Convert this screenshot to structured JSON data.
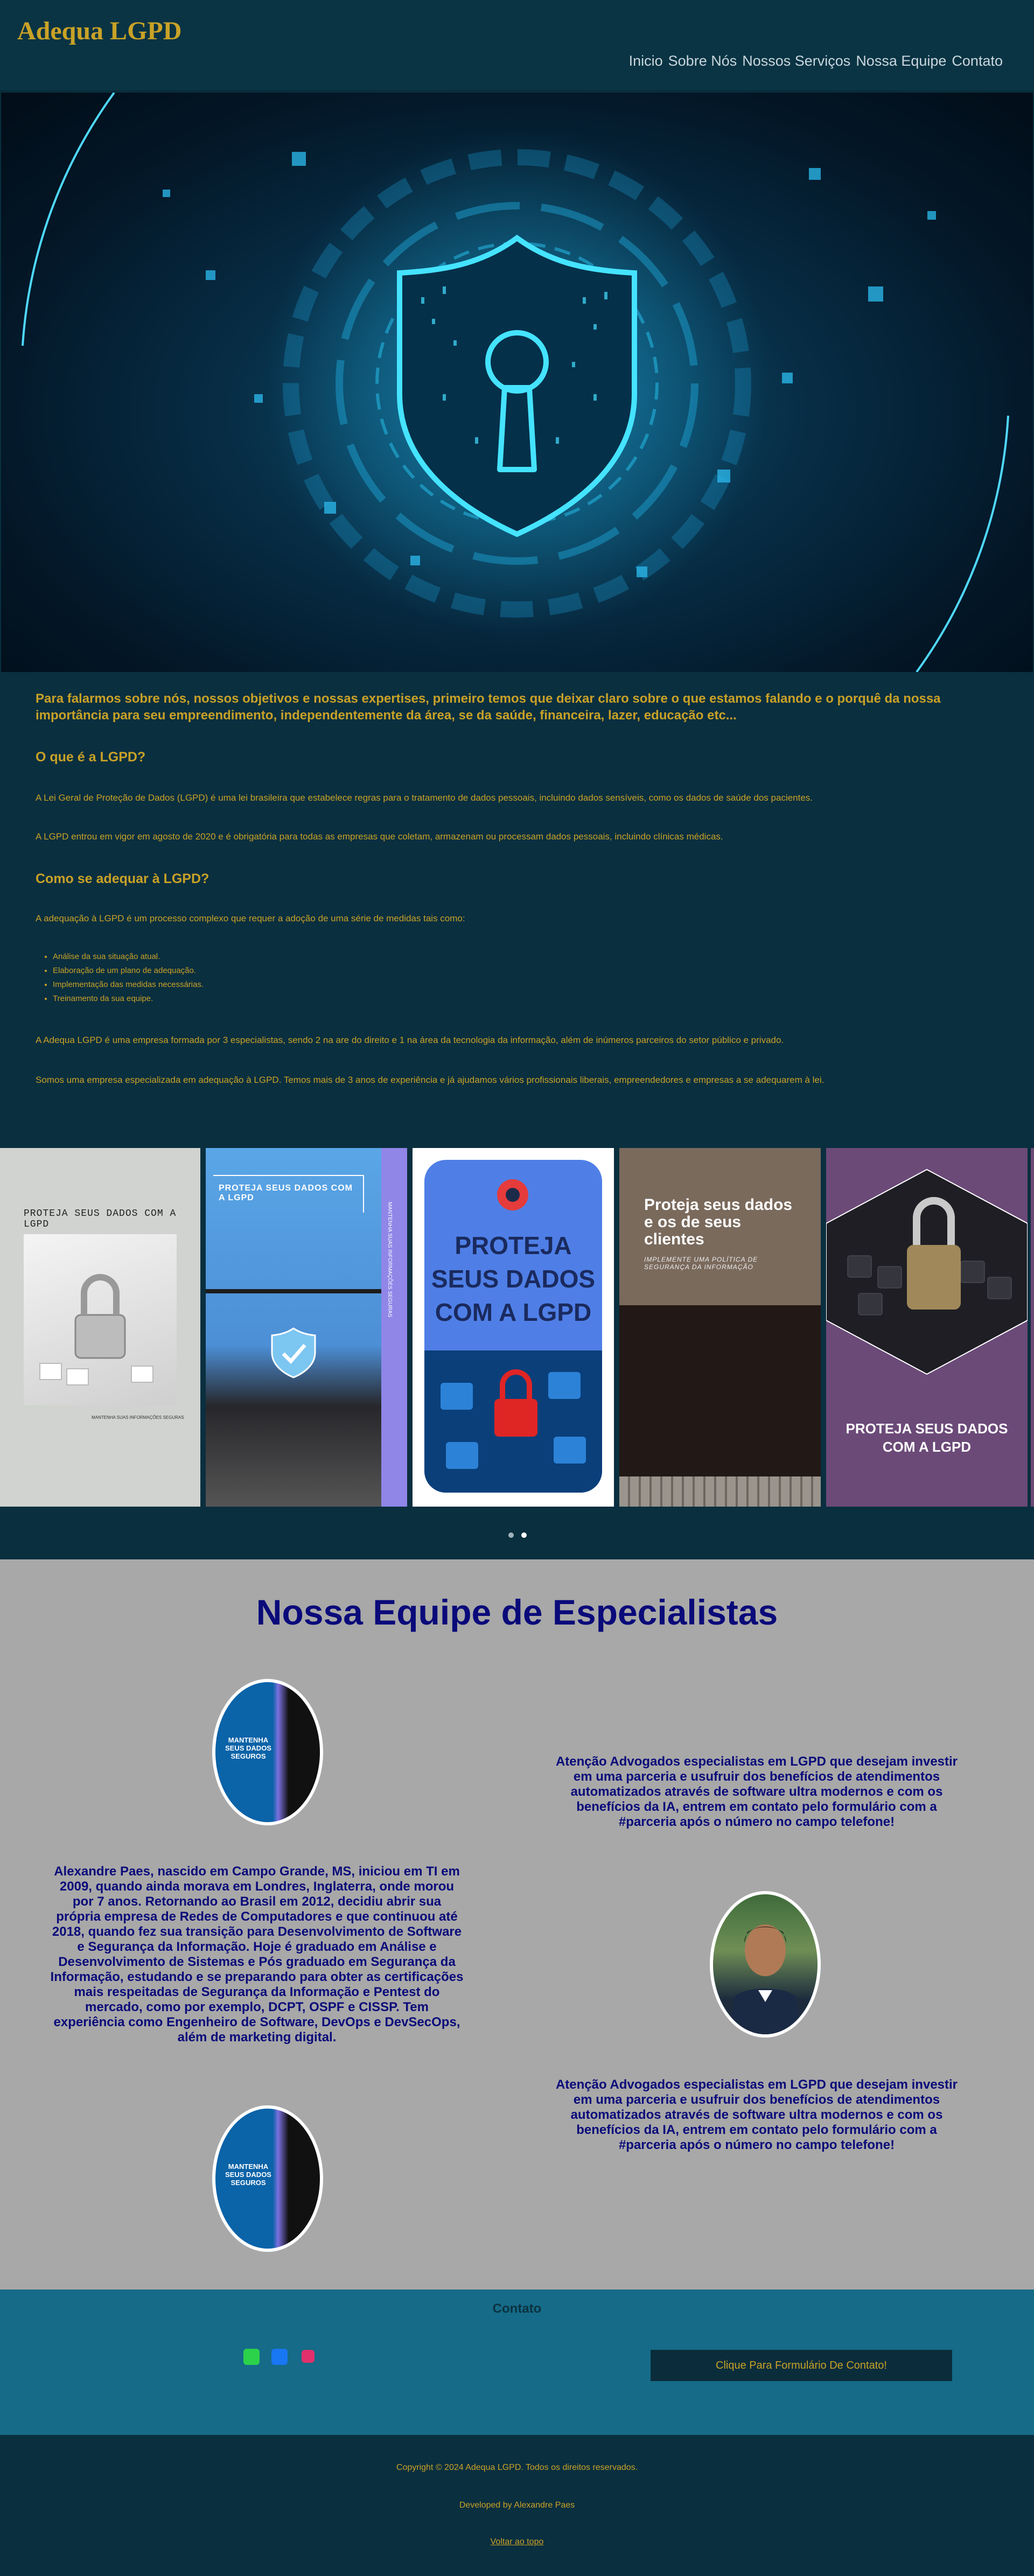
{
  "header": {
    "brand": "Adequa LGPD",
    "nav": [
      "Inicio",
      "Sobre Nós",
      "Nossos Serviços",
      "Nossa Equipe",
      "Contato"
    ]
  },
  "intro": {
    "lead": "Para falarmos sobre nós, nossos objetivos e nossas expertises, primeiro temos que deixar claro sobre o que estamos falando e o porquê da nossa importância para seu empreendimento, independentemente da área, se da saúde, financeira, lazer, educação etc...",
    "what_title": "O que é a LGPD?",
    "what_p1": "A Lei Geral de Proteção de Dados (LGPD) é uma lei brasileira que estabelece regras para o tratamento de dados pessoais, incluindo dados sensíveis, como os dados de saúde dos pacientes.",
    "what_p2": "A LGPD entrou em vigor em agosto de 2020 e é obrigatória para todas as empresas que coletam, armazenam ou processam dados pessoais, incluindo clínicas médicas.",
    "how_title": "Como se adequar à LGPD?",
    "how_p": "A adequação à LGPD é um processo complexo que requer a adoção de uma série de medidas tais como:",
    "steps": [
      "Análise da sua situação atual.",
      "Elaboração de um plano de adequação.",
      "Implementação das medidas necessárias.",
      "Treinamento da sua equipe."
    ],
    "about_p1": "A Adequa LGPD é uma empresa formada por 3 especialistas, sendo 2 na are do direito e 1 na área da tecnologia da informação, além de inúmeros parceiros do setor público e privado.",
    "about_p2": "Somos uma empresa especializada em adequação à LGPD. Temos mais de 3 anos de experiência e já ajudamos vários profissionais liberais, empreendedores e empresas a se adequarem à lei."
  },
  "carousel": {
    "slide1_title": "PROTEJA SEUS DADOS COM A LGPD",
    "slide1_caption": "MANTENHA SUAS INFORMAÇÕES SEGURAS",
    "slide2_title": "PROTEJA SEUS DADOS COM A LGPD",
    "slide2_side": "MANTENHA SUAS INFORMAÇÕES SEGURAS",
    "slide3_title": "PROTEJA SEUS DADOS COM A LGPD",
    "slide4_title": "Proteja seus dados e os de seus clientes",
    "slide4_sub": "IMPLEMENTE UMA POLÍTICA DE SEGURANÇA DA INFORMAÇÃO",
    "slide5_title": "PROTEJA SEUS DADOS COM A LGPD",
    "active_dot": 1
  },
  "team": {
    "title": "Nossa Equipe de Especialistas",
    "badge_text": "MANTENHA SEUS DADOS SEGUROS",
    "callout1": "Atenção Advogados especialistas em LGPD que desejam investir em uma parceria e usufruir dos benefícios de atendimentos automatizados através de software ultra modernos e com os benefícios da IA, entrem em contato pelo formulário com a #parceria após o número no campo telefone!",
    "bio": "Alexandre Paes, nascido em Campo Grande, MS, iniciou em TI em 2009, quando ainda morava em Londres, Inglaterra, onde morou por 7 anos. Retornando ao Brasil em 2012, decidiu abrir sua própria empresa de Redes de Computadores e que continuou até 2018, quando fez sua transição para Desenvolvimento de Software e Segurança da Informação. Hoje é graduado em Análise e Desenvolvimento de Sistemas e Pós graduado em Segurança da Informação, estudando e se preparando para obter as certificações mais respeitadas de Segurança da Informação e Pentest do mercado, como por exemplo, DCPT, OSPF e CISSP. Tem experiência como Engenheiro de Software, DevOps e DevSecOps, além de marketing digital.",
    "callout2": "Atenção Advogados especialistas em LGPD que desejam investir em uma parceria e usufruir dos benefícios de atendimentos automatizados através de software ultra modernos e com os benefícios da IA, entrem em contato pelo formulário com a #parceria após o número no campo telefone!"
  },
  "contact": {
    "title": "Contato",
    "button": "Clique Para Formulário De Contato!"
  },
  "footer": {
    "copyright": "Copyright © 2024 Adequa LGPD. Todos os direitos reservados.",
    "developed": "Developed by Alexandre Paes",
    "back_top": "Voltar ao topo"
  },
  "colors": {
    "gold": "#c9a227",
    "navy_text": "#0a0a7a",
    "dark_teal": "#0a2f3f",
    "contact_bg": "#156b88"
  }
}
